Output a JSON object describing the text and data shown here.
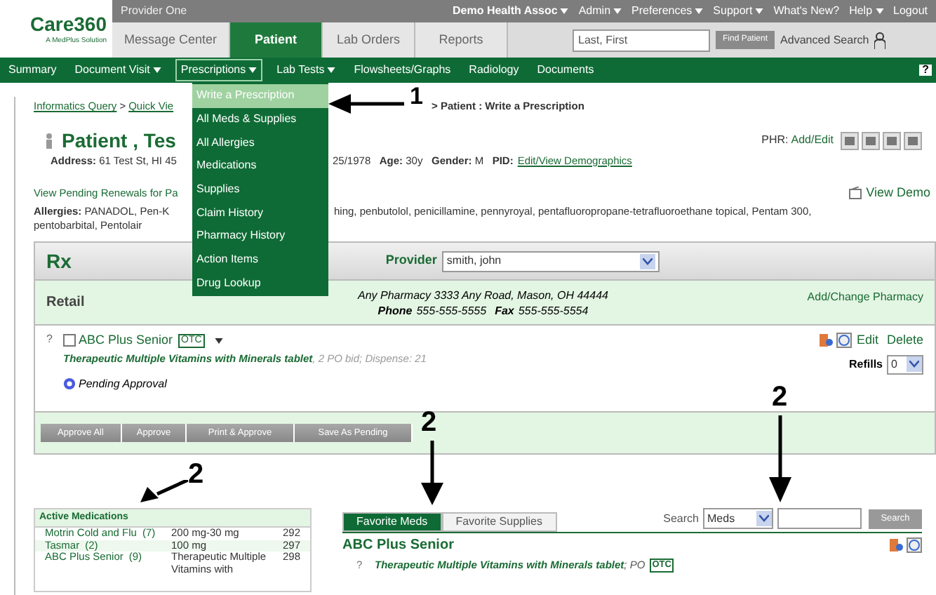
{
  "logo": {
    "name": "Care360",
    "tagline": "A MedPlus Solution"
  },
  "top_bar": {
    "provider": "Provider One",
    "menus": [
      {
        "label": "Demo Health Assoc",
        "bold": true,
        "dropdown": true
      },
      {
        "label": "Admin",
        "bold": false,
        "dropdown": true
      },
      {
        "label": "Preferences",
        "bold": false,
        "dropdown": true
      },
      {
        "label": "Support",
        "bold": false,
        "dropdown": true
      },
      {
        "label": "What's New?",
        "bold": false,
        "dropdown": false
      },
      {
        "label": "Help",
        "bold": false,
        "dropdown": true
      },
      {
        "label": "Logout",
        "bold": false,
        "dropdown": false
      }
    ]
  },
  "main_tabs": [
    {
      "label": "Message Center",
      "selected": false
    },
    {
      "label": "Patient",
      "selected": true
    },
    {
      "label": "Lab Orders",
      "selected": false
    },
    {
      "label": "Reports",
      "selected": false
    }
  ],
  "patient_search": {
    "placeholder": "Last, First",
    "button": "Find Patient",
    "advanced": "Advanced Search"
  },
  "nav": [
    {
      "label": "Summary",
      "dropdown": false,
      "selected": false
    },
    {
      "label": "Document Visit",
      "dropdown": true,
      "selected": false
    },
    {
      "label": "Prescriptions",
      "dropdown": true,
      "selected": true
    },
    {
      "label": "Lab Tests",
      "dropdown": true,
      "selected": false
    },
    {
      "label": "Flowsheets/Graphs",
      "dropdown": false,
      "selected": false
    },
    {
      "label": "Radiology",
      "dropdown": false,
      "selected": false
    },
    {
      "label": "Documents",
      "dropdown": false,
      "selected": false
    }
  ],
  "help": "?",
  "prescriptions_menu": [
    {
      "label": "Write a Prescription",
      "selected": true
    },
    {
      "label": "All Meds & Supplies",
      "selected": false
    },
    {
      "label": "All Allergies",
      "selected": false
    },
    {
      "label": "Medications",
      "selected": false
    },
    {
      "label": "Supplies",
      "selected": false
    },
    {
      "label": "Claim History",
      "selected": false
    },
    {
      "label": "Pharmacy History",
      "selected": false
    },
    {
      "label": "Action Items",
      "selected": false
    },
    {
      "label": "Drug Lookup",
      "selected": false
    }
  ],
  "breadcrumb": {
    "links": [
      "Informatics Query",
      "Quick Vie"
    ],
    "separator": ">",
    "current": "> Patient : Write a Prescription"
  },
  "patient": {
    "name": "Patient , Tes",
    "address": "**Address:** 61 Test St, HI 45",
    "details": "25/1978   **Age:** 30y   **Gender:** M   **PID:**",
    "pid_link": "Edit/View Demographics",
    "phr_label": "PHR:",
    "phr_link": "Add/Edit"
  },
  "pending_renewals": "View Pending Renewals for Pa",
  "view_demo": "View Demo",
  "allergies": {
    "left": "**Allergies:** PANADOL, Pen-K",
    "right": "hing, penbutolol, penicillamine, pennyroyal, pentafluoropropane-tetrafluoroethane topical, Pentam 300,",
    "line2": "pentobarbital, Pentolair"
  },
  "rx": {
    "title": "Rx",
    "provider_label": "Provider",
    "provider": "smith, john"
  },
  "pharmacy": {
    "type": "Retail",
    "address": "Any Pharmacy 3333 Any Road, Mason, OH 44444",
    "phone_label": "Phone",
    "phone": "555-555-5555",
    "fax_label": "Fax",
    "fax": "555-555-5554",
    "change": "Add/Change Pharmacy"
  },
  "prescription": {
    "help": "?",
    "checked": false,
    "name": "ABC Plus Senior",
    "badge": "OTC",
    "drug": "Therapeutic Multiple Vitamins with Minerals tablet",
    "sig": ", 2 PO bid; Dispense: 21",
    "status": "Pending Approval",
    "edit": "Edit",
    "delete": "Delete",
    "refills_label": "Refills",
    "refills": "0"
  },
  "actions": [
    "Approve All",
    "Approve",
    "Print & Approve",
    "Save As Pending"
  ],
  "active_medications": {
    "title": "Active Medications",
    "rows": [
      {
        "name": "Motrin Cold and Flu",
        "count": "(7)",
        "dose": "200 mg-30 mg",
        "number": "292"
      },
      {
        "name": "Tasmar",
        "count": "(2)",
        "dose": "100 mg",
        "number": "297"
      },
      {
        "name": "ABC Plus Senior",
        "count": "(9)",
        "dose": "Therapeutic Multiple Vitamins with",
        "number": "298"
      }
    ]
  },
  "favorites": {
    "tabs": [
      {
        "label": "Favorite Meds",
        "selected": true
      },
      {
        "label": "Favorite Supplies",
        "selected": false
      }
    ],
    "search_label": "Search",
    "search_type": "Meds",
    "search_button": "Search",
    "items": [
      {
        "name": "ABC Plus Senior",
        "help": "?",
        "drug": "Therapeutic Multiple Vitamins with Minerals tablet",
        "route": "; PO",
        "badge": "OTC"
      }
    ]
  },
  "annotations": [
    "1",
    "2",
    "2",
    "2"
  ]
}
